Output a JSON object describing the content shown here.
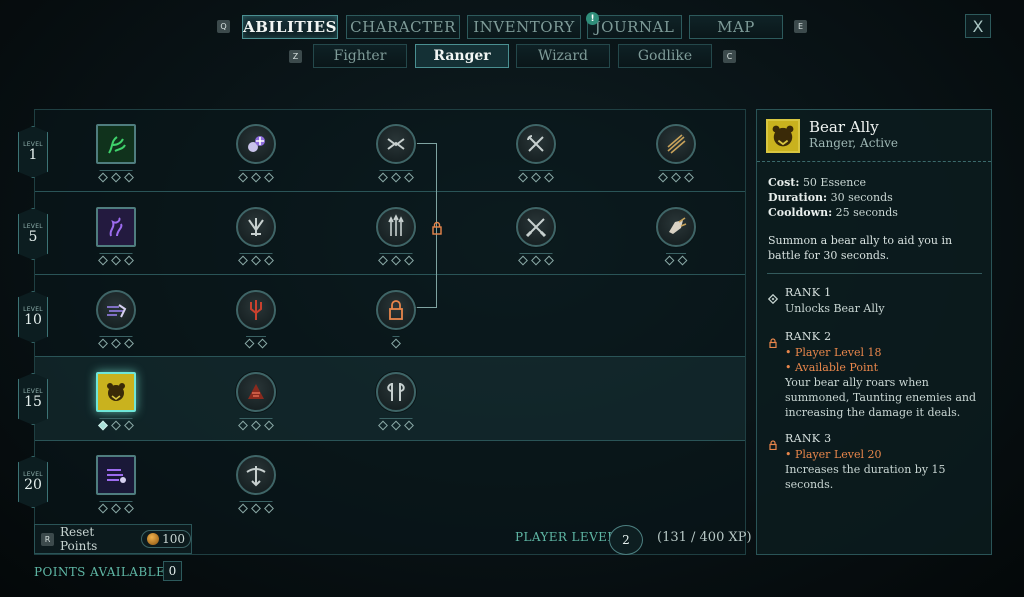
{
  "nav": {
    "tabs": [
      "ABILITIES",
      "CHARACTER",
      "INVENTORY",
      "JOURNAL",
      "MAP"
    ],
    "active_tab": "ABILITIES",
    "left_key": "Q",
    "right_key": "E",
    "journal_alert": "!",
    "close_label": "X"
  },
  "subnav": {
    "tabs": [
      "Fighter",
      "Ranger",
      "Wizard",
      "Godlike"
    ],
    "active_tab": "Ranger",
    "left_key": "Z",
    "right_key": "C"
  },
  "tree": {
    "levels": [
      {
        "label": "LEVEL",
        "num": "1"
      },
      {
        "label": "LEVEL",
        "num": "5"
      },
      {
        "label": "LEVEL",
        "num": "10"
      },
      {
        "label": "LEVEL",
        "num": "15"
      },
      {
        "label": "LEVEL",
        "num": "20"
      }
    ],
    "icon_colors": {
      "green": "#3fd26b",
      "purple": "#9d6cf0",
      "gold": "#d8c640",
      "red": "#c9412e",
      "lock": "#e8864b"
    }
  },
  "bottom": {
    "reset_key": "R",
    "reset_label": "Reset Points",
    "reset_cost": "100",
    "player_level_label": "PLAYER LEVEL",
    "player_level": "2",
    "xp": "(131 / 400 XP)",
    "points_available_label": "POINTS AVAILABLE",
    "points_available": "0"
  },
  "detail": {
    "title": "Bear Ally",
    "subtitle": "Ranger, Active",
    "cost_label": "Cost:",
    "cost_value": "50 Essence",
    "duration_label": "Duration:",
    "duration_value": "30 seconds",
    "cooldown_label": "Cooldown:",
    "cooldown_value": "25 seconds",
    "description": "Summon a bear ally to aid you in battle for 30 seconds.",
    "rank1": {
      "title": "RANK 1",
      "text": "Unlocks Bear Ally"
    },
    "rank2": {
      "title": "RANK 2",
      "req1": "• Player Level 18",
      "req2": "• Available Point",
      "text": "Your bear ally roars when summoned, Taunting enemies and increasing the damage it deals."
    },
    "rank3": {
      "title": "RANK 3",
      "req1": "• Player Level 20",
      "text": "Increases the duration by 15 seconds."
    }
  }
}
